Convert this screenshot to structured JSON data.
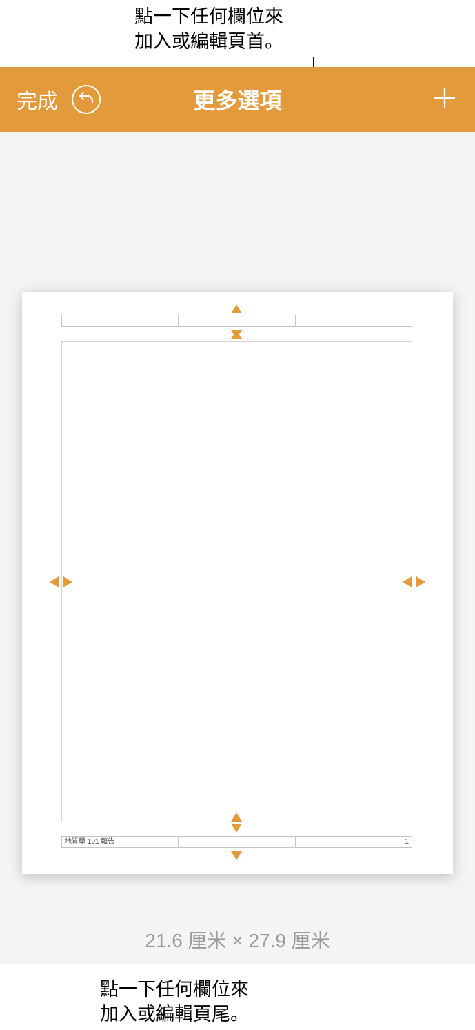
{
  "callouts": {
    "top": "點一下任何欄位來\n加入或編輯頁首。",
    "bottom": "點一下任何欄位來\n加入或編輯頁尾。"
  },
  "toolbar": {
    "done_label": "完成",
    "title": "更多選項"
  },
  "page": {
    "header": {
      "left": "",
      "center": "",
      "right": ""
    },
    "footer": {
      "left": "地質學 101 報告",
      "center": "",
      "right": "1"
    }
  },
  "page_size_label": "21.6 厘米 × 27.9 厘米"
}
